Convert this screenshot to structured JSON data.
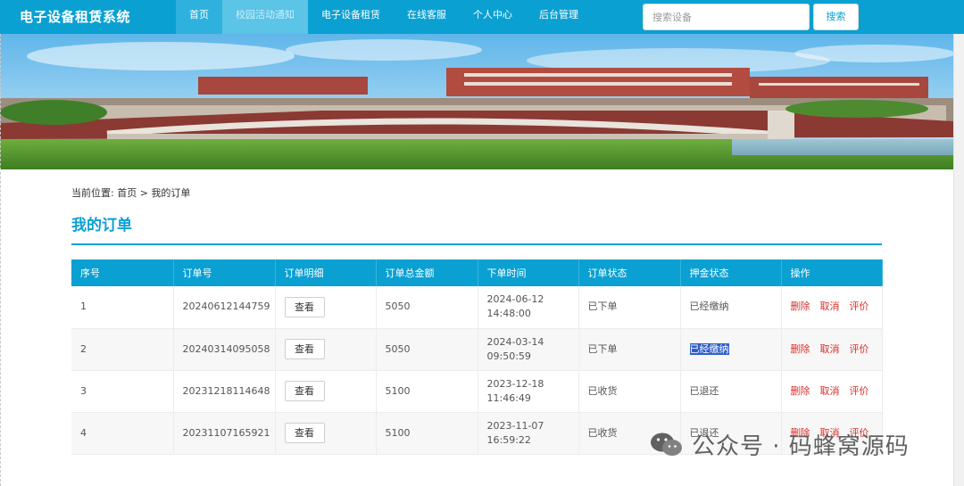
{
  "header": {
    "brand": "电子设备租赁系统",
    "nav": [
      {
        "label": "首页"
      },
      {
        "label": "校园活动通知"
      },
      {
        "label": "电子设备租赁"
      },
      {
        "label": "在线客服"
      },
      {
        "label": "个人中心"
      },
      {
        "label": "后台管理"
      }
    ],
    "search": {
      "placeholder": "搜索设备",
      "button": "搜索"
    }
  },
  "breadcrumb": {
    "prefix": "当前位置:",
    "home": "首页",
    "sep": ">",
    "current": "我的订单"
  },
  "page": {
    "title": "我的订单"
  },
  "table": {
    "columns": [
      "序号",
      "订单号",
      "订单明细",
      "订单总金额",
      "下单时间",
      "订单状态",
      "押金状态",
      "操作"
    ],
    "rows": [
      {
        "no": "1",
        "order_id": "20240612144759",
        "detail": "查看",
        "amount": "5050",
        "time": "2024-06-12 14:48:00",
        "status": "已下单",
        "deposit": "已经缴纳"
      },
      {
        "no": "2",
        "order_id": "20240314095058",
        "detail": "查看",
        "amount": "5050",
        "time": "2024-03-14 09:50:59",
        "status": "已下单",
        "deposit": "已经缴纳"
      },
      {
        "no": "3",
        "order_id": "20231218114648",
        "detail": "查看",
        "amount": "5100",
        "time": "2023-12-18 11:46:49",
        "status": "已收货",
        "deposit": "已退还"
      },
      {
        "no": "4",
        "order_id": "20231107165921",
        "detail": "查看",
        "amount": "5100",
        "time": "2023-11-07 16:59:22",
        "status": "已收货",
        "deposit": "已退还"
      }
    ],
    "actions": {
      "delete": "删除",
      "cancel": "取消",
      "review": "评价"
    }
  },
  "watermark": {
    "text": "公众号 · 码蜂窝源码",
    "icon": "wechat-icon"
  },
  "colors": {
    "primary": "#0aa0d2",
    "danger": "#d9302b",
    "selection": "#2f5fc7"
  }
}
